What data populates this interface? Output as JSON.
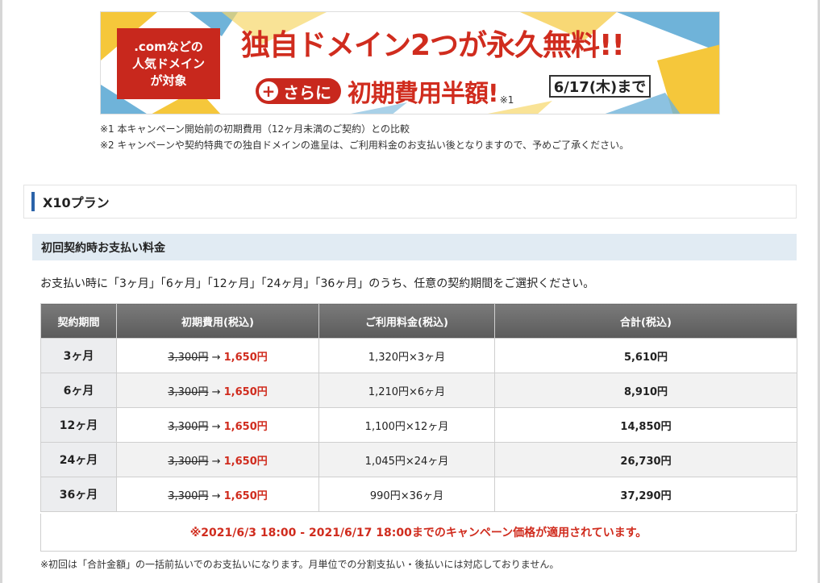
{
  "banner": {
    "badge_lines": [
      ".comなどの",
      "人気ドメイン",
      "が対象"
    ],
    "headline": "独自ドメイン2つが永久無料!!",
    "plus_label": "さらに",
    "sub_headline": "初期費用半額!",
    "sub_note_ref": "※1",
    "deadline": "6/17(木)まで",
    "colors": {
      "red": "#c8281d",
      "yellow": "#f5c73b",
      "blue": "#6fb3d9"
    }
  },
  "notes": [
    "※1 本キャンペーン開始前の初期費用（12ヶ月未満のご契約）との比較",
    "※2 キャンペーンや契約特典での独自ドメインの進呈は、ご利用料金のお支払い後となりますので、予めご了承ください。"
  ],
  "plan": {
    "title": "X10プラン"
  },
  "section": {
    "title": "初回契約時お支払い料金",
    "description": "お支払い時に「3ヶ月」「6ヶ月」「12ヶ月」「24ヶ月」「36ヶ月」のうち、任意の契約期間をご選択ください。"
  },
  "table": {
    "headers": [
      "契約期間",
      "初期費用(税込)",
      "ご利用料金(税込)",
      "合計(税込)"
    ],
    "rows": [
      {
        "period": "3ヶ月",
        "old_fee": "3,300円",
        "arrow": "→",
        "new_fee": "1,650円",
        "usage": "1,320円×3ヶ月",
        "total": "5,610円"
      },
      {
        "period": "6ヶ月",
        "old_fee": "3,300円",
        "arrow": "→",
        "new_fee": "1,650円",
        "usage": "1,210円×6ヶ月",
        "total": "8,910円"
      },
      {
        "period": "12ヶ月",
        "old_fee": "3,300円",
        "arrow": "→",
        "new_fee": "1,650円",
        "usage": "1,100円×12ヶ月",
        "total": "14,850円"
      },
      {
        "period": "24ヶ月",
        "old_fee": "3,300円",
        "arrow": "→",
        "new_fee": "1,650円",
        "usage": "1,045円×24ヶ月",
        "total": "26,730円"
      },
      {
        "period": "36ヶ月",
        "old_fee": "3,300円",
        "arrow": "→",
        "new_fee": "1,650円",
        "usage": "990円×36ヶ月",
        "total": "37,290円"
      }
    ],
    "campaign_note": "※2021/6/3 18:00 - 2021/6/17 18:00までのキャンペーン価格が適用されています。"
  },
  "bottom_note": "※初回は「合計金額」の一括前払いでのお支払いになります。月単位での分割支払い・後払いには対応しておりません。"
}
